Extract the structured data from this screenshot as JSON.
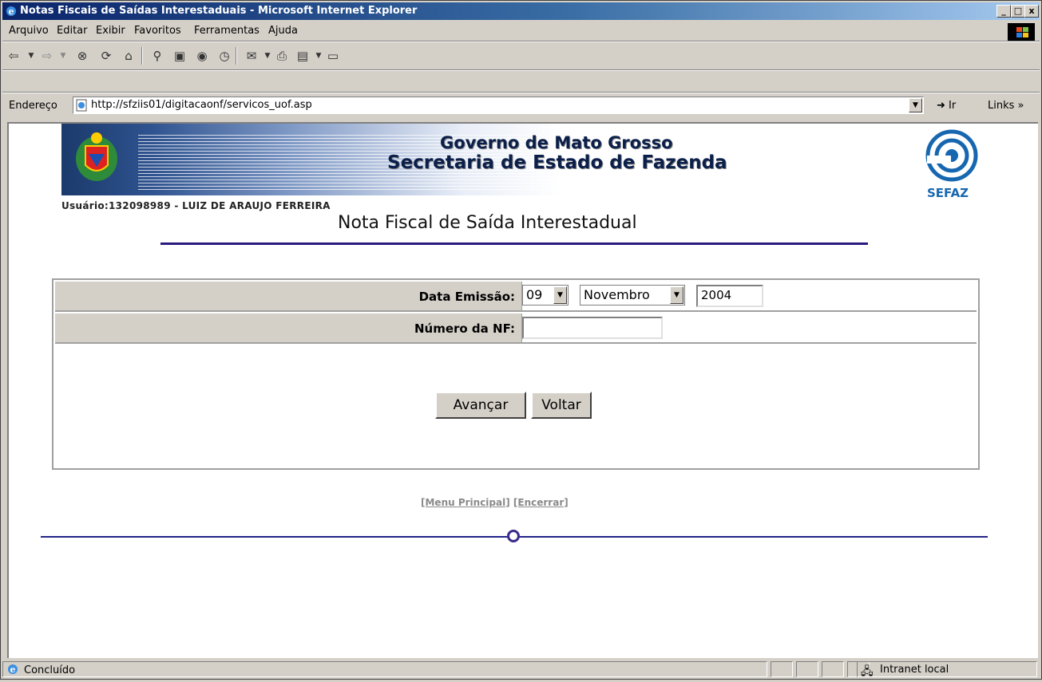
{
  "window": {
    "title": "Notas Fiscais de Saídas Interestaduais - Microsoft Internet Explorer",
    "minimize": "_",
    "maximize": "□",
    "close": "x"
  },
  "menu": [
    "Arquivo",
    "Editar",
    "Exibir",
    "Favoritos",
    "Ferramentas",
    "Ajuda"
  ],
  "toolbar_icons": [
    "back-icon",
    "forward-icon",
    "stop-icon",
    "refresh-icon",
    "home-icon",
    "search-icon",
    "favorites-icon",
    "history-icon",
    "mail-icon",
    "print-icon",
    "edit-icon",
    "discuss-icon"
  ],
  "address": {
    "label": "Endereço",
    "url": "http://sfziis01/digitacaonf/servicos_uof.asp",
    "go": "Ir",
    "links": "Links »"
  },
  "banner": {
    "line1": "Governo de Mato Grosso",
    "line2": "Secretaria de Estado de Fazenda",
    "logo_label": "SEFAZ"
  },
  "user": "Usuário:132098989 - LUIZ DE ARAUJO FERREIRA",
  "heading": "Nota Fiscal de Saída Interestadual",
  "form": {
    "date_label": "Data Emissão:",
    "day": "09",
    "month": "Novembro",
    "year": "2004",
    "nf_label": "Número da NF:",
    "nf_value": ""
  },
  "buttons": {
    "next": "Avançar",
    "back": "Voltar"
  },
  "footer_links": {
    "menu": "[Menu Principal]",
    "close": "[Encerrar]"
  },
  "status": {
    "text": "Concluído",
    "zone": "Intranet local"
  },
  "colors": {
    "titlebar": "#0a246a",
    "accent_rule": "#2a1a80",
    "link_gray": "#8a8a8a"
  }
}
